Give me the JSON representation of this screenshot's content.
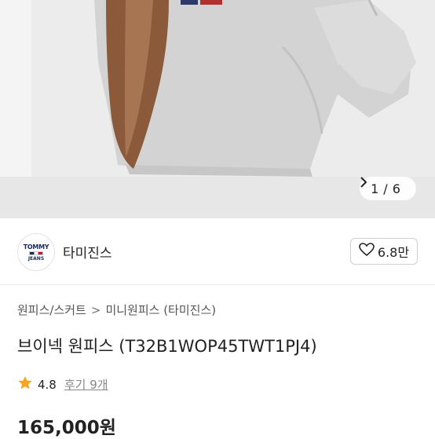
{
  "gallery": {
    "pager_current": "1",
    "pager_sep": "/",
    "pager_total": "6",
    "next_icon": "chevron-right-icon"
  },
  "brand": {
    "logo_line1": "TOMMY",
    "logo_line2": "JEANS",
    "name": "타미진스",
    "like_count": "6.8만",
    "like_icon": "heart-outline-icon"
  },
  "breadcrumb": {
    "items": [
      "원피스/스커트",
      "미니원피스 (타미진스)"
    ],
    "separator": ">"
  },
  "product": {
    "title": "브이넥 원피스 (T32B1WOP45TWT1PJ4)",
    "rating": "4.8",
    "review_label": "후기 9개",
    "price": "165,000원"
  },
  "colors": {
    "star": "#f5a623",
    "photo_bg": "#ececec"
  }
}
